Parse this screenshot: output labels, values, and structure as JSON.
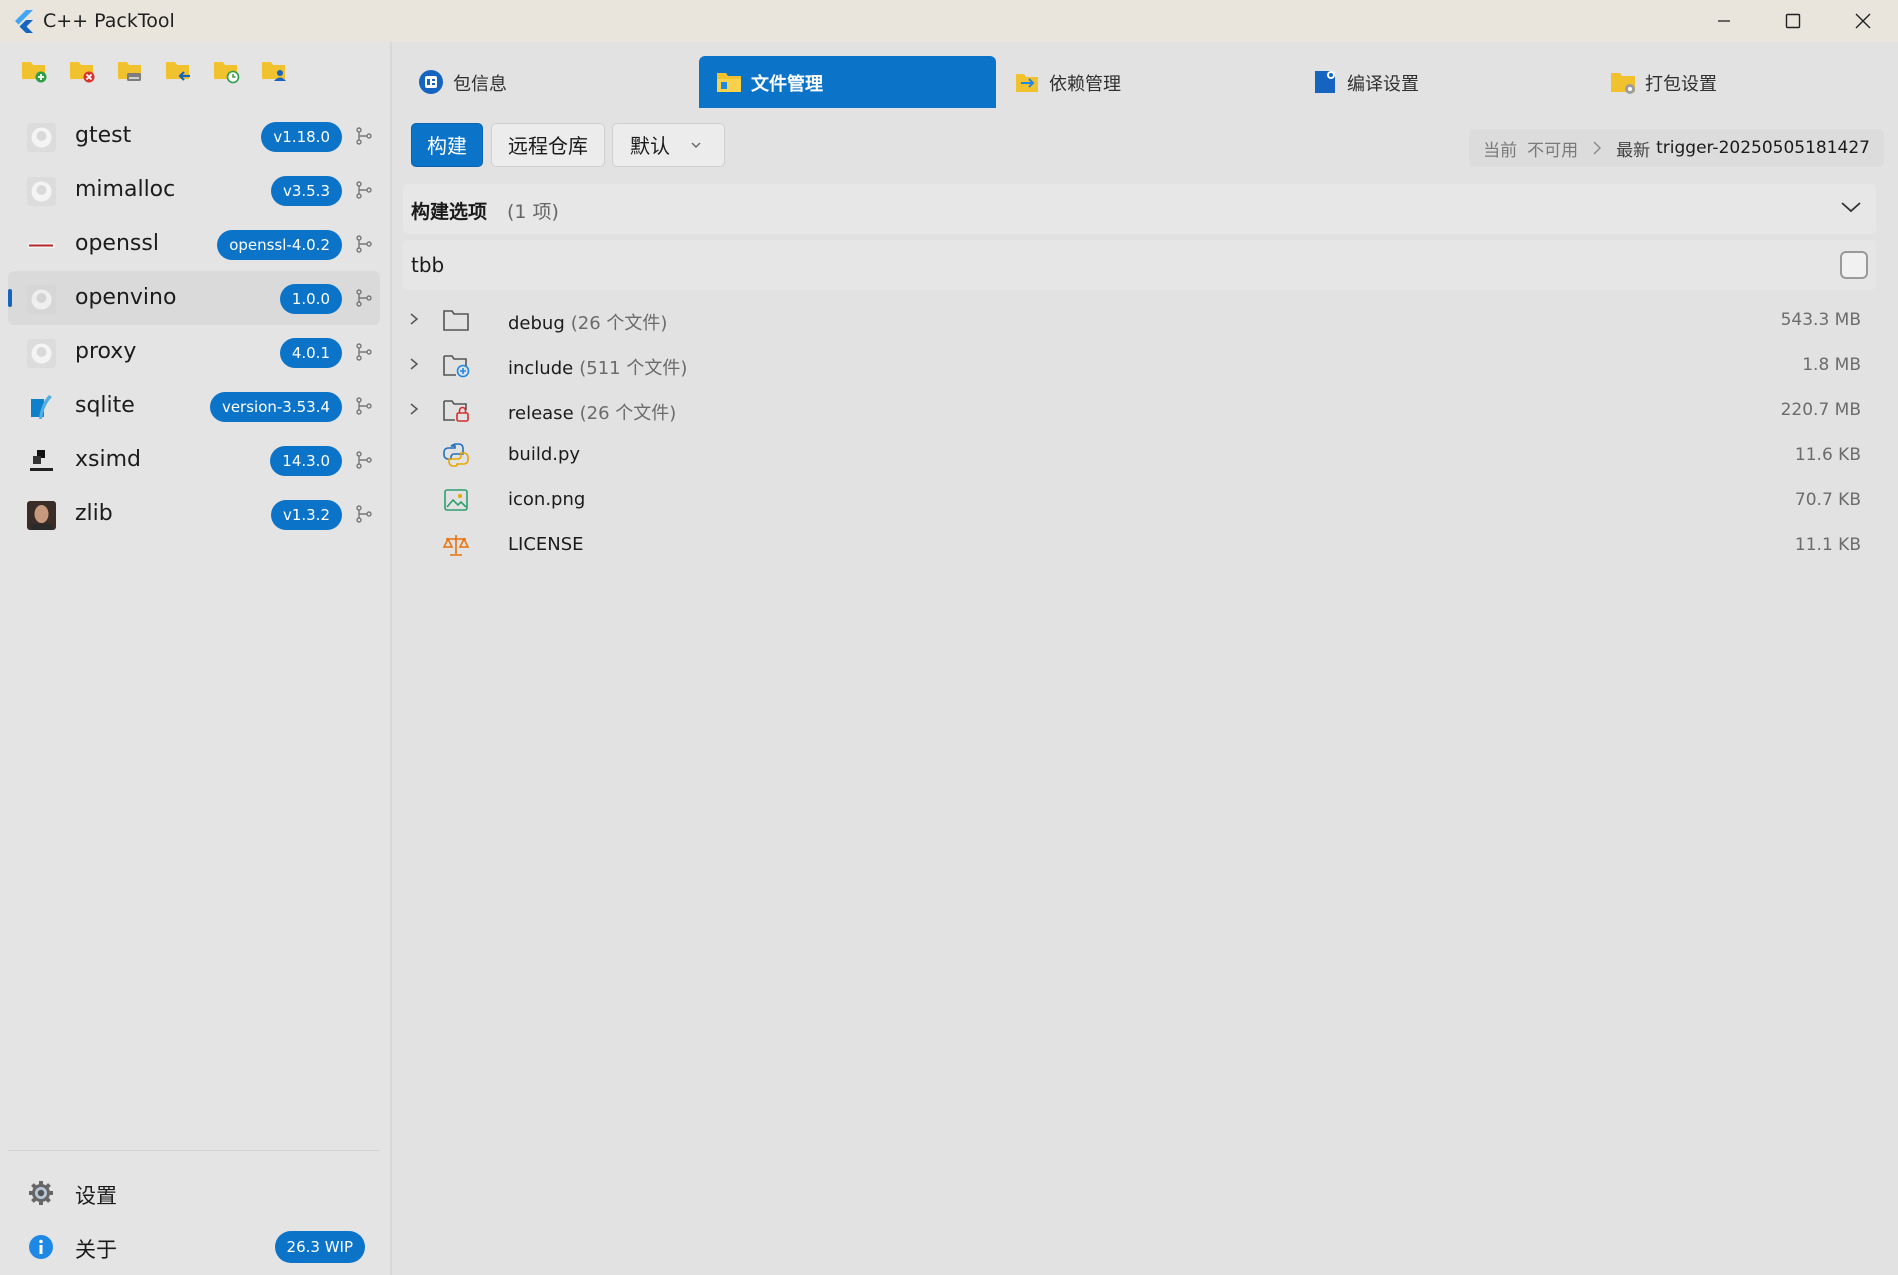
{
  "window": {
    "title": "C++ PackTool"
  },
  "sidebar": {
    "toolbar_icons": [
      "add-folder-icon",
      "delete-folder-icon",
      "disk-folder-icon",
      "import-folder-icon",
      "sync-folder-icon",
      "user-folder-icon"
    ],
    "packages": [
      {
        "name": "gtest",
        "version": "v1.18.0",
        "avatar": "github"
      },
      {
        "name": "mimalloc",
        "version": "v3.5.3",
        "avatar": "github"
      },
      {
        "name": "openssl",
        "version": "openssl-4.0.2",
        "avatar": "openssl"
      },
      {
        "name": "openvino",
        "version": "1.0.0",
        "avatar": "github",
        "active": true
      },
      {
        "name": "proxy",
        "version": "4.0.1",
        "avatar": "github"
      },
      {
        "name": "sqlite",
        "version": "version-3.53.4",
        "avatar": "sqlite"
      },
      {
        "name": "xsimd",
        "version": "14.3.0",
        "avatar": "xtensor"
      },
      {
        "name": "zlib",
        "version": "v1.3.2",
        "avatar": "photo"
      }
    ],
    "settings_label": "设置",
    "about_label": "关于",
    "about_badge": "26.3 WIP"
  },
  "tabs": [
    {
      "label": "包信息",
      "icon": "info-card-icon"
    },
    {
      "label": "文件管理",
      "icon": "file-explorer-icon",
      "active": true
    },
    {
      "label": "依赖管理",
      "icon": "dependency-icon"
    },
    {
      "label": "编译设置",
      "icon": "compile-settings-icon"
    },
    {
      "label": "打包设置",
      "icon": "package-settings-icon"
    }
  ],
  "actions": {
    "build_label": "构建",
    "remote_label": "远程仓库",
    "default_label": "默认"
  },
  "version": {
    "current_prefix": "当前",
    "current_value": "不可用",
    "latest_prefix": "最新",
    "latest_value": "trigger-20250505181427"
  },
  "build_options": {
    "title": "构建选项",
    "count": "(1 项)",
    "options": [
      {
        "label": "tbb",
        "checked": false
      }
    ]
  },
  "files": [
    {
      "name": "debug",
      "count": "(26 个文件)",
      "size": "543.3 MB",
      "type": "folder",
      "expandable": true
    },
    {
      "name": "include",
      "count": "(511 个文件)",
      "size": "1.8 MB",
      "type": "folder-add",
      "expandable": true
    },
    {
      "name": "release",
      "count": "(26 个文件)",
      "size": "220.7 MB",
      "type": "folder-lock",
      "expandable": true
    },
    {
      "name": "build.py",
      "count": "",
      "size": "11.6 KB",
      "type": "python",
      "expandable": false
    },
    {
      "name": "icon.png",
      "count": "",
      "size": "70.7 KB",
      "type": "image",
      "expandable": false
    },
    {
      "name": "LICENSE",
      "count": "",
      "size": "11.1 KB",
      "type": "license",
      "expandable": false
    }
  ],
  "colors": {
    "accent": "#0b74c9",
    "background": "#e3e3e3",
    "titlebar": "#e9e5dc"
  }
}
